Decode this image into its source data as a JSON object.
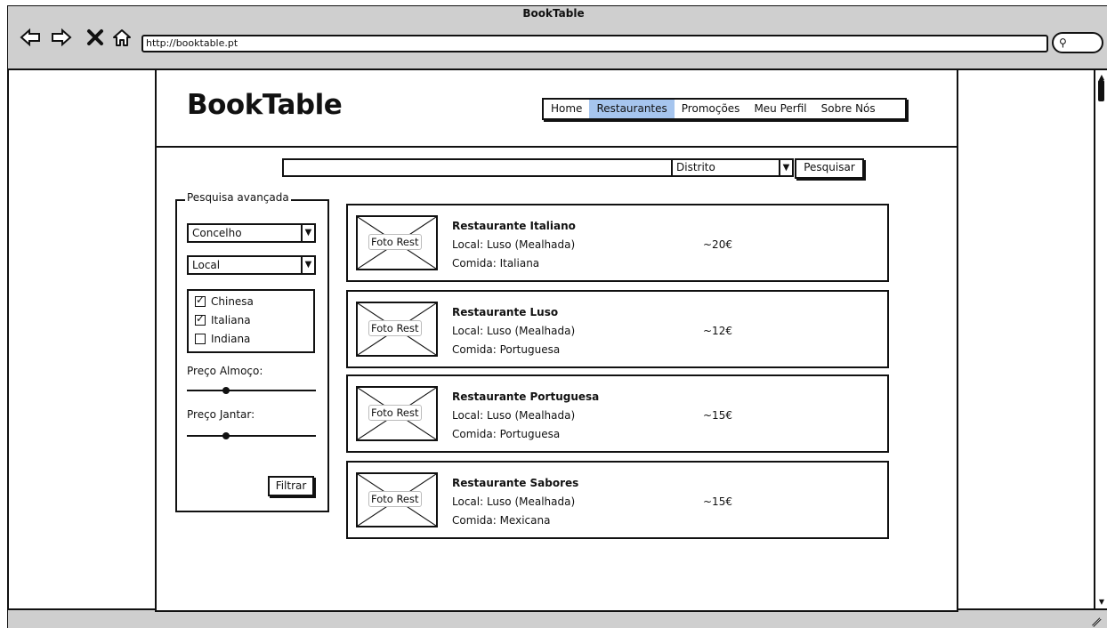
{
  "browser": {
    "window_title": "BookTable",
    "url": "http://booktable.pt",
    "icons": [
      "back-icon",
      "forward-icon",
      "close-icon",
      "home-icon",
      "search-icon"
    ]
  },
  "site": {
    "logo": "BookTable",
    "nav": [
      {
        "label": "Home",
        "active": false
      },
      {
        "label": "Restaurantes",
        "active": true
      },
      {
        "label": "Promoções",
        "active": false
      },
      {
        "label": "Meu Perfil",
        "active": false
      },
      {
        "label": "Sobre Nós",
        "active": false
      }
    ]
  },
  "search": {
    "query": "",
    "district_select": "Distrito",
    "button": "Pesquisar"
  },
  "advanced": {
    "legend": "Pesquisa avançada",
    "concelho_select": "Concelho",
    "local_select": "Local",
    "cuisines": [
      {
        "label": "Chinesa",
        "checked": true
      },
      {
        "label": "Italiana",
        "checked": true
      },
      {
        "label": "Indiana",
        "checked": false
      }
    ],
    "lunch_price_label": "Preço Almoço:",
    "lunch_price_value": 0.3,
    "dinner_price_label": "Preço Jantar:",
    "dinner_price_value": 0.3,
    "filter_button": "Filtrar"
  },
  "restaurants": [
    {
      "photo": "Foto Rest",
      "name": "Restaurante Italiano",
      "local": "Local: Luso (Mealhada)",
      "food": "Comida: Italiana",
      "price": "~20€"
    },
    {
      "photo": "Foto Rest",
      "name": "Restaurante Luso",
      "local": "Local: Luso (Mealhada)",
      "food": "Comida: Portuguesa",
      "price": "~12€"
    },
    {
      "photo": "Foto Rest",
      "name": "Restaurante Portuguesa",
      "local": "Local: Luso (Mealhada)",
      "food": "Comida: Portuguesa",
      "price": "~15€"
    },
    {
      "photo": "Foto Rest",
      "name": "Restaurante Sabores",
      "local": "Local: Luso (Mealhada)",
      "food": "Comida: Mexicana",
      "price": "~15€"
    }
  ],
  "colors": {
    "chrome": "#cfcfcf",
    "active_nav": "#a6c5ee",
    "ink": "#111111"
  }
}
